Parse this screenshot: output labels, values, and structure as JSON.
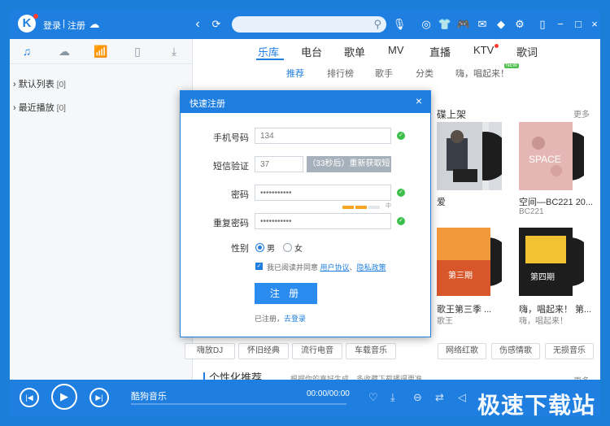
{
  "topbar": {
    "logo": "K",
    "login": "登录",
    "separator": "|",
    "register": "注册",
    "search_placeholder": ""
  },
  "sidebar": {
    "tabs": [
      "music-note-icon",
      "cloud-icon",
      "radio-icon",
      "device-icon",
      "download-icon"
    ],
    "items": [
      {
        "label": "默认列表",
        "count": "[0]"
      },
      {
        "label": "最近播放",
        "count": "[0]"
      }
    ]
  },
  "nav": {
    "items": [
      "乐库",
      "电台",
      "歌单",
      "MV",
      "直播",
      "KTV",
      "歌词"
    ],
    "active": "乐库"
  },
  "subnav": {
    "items": [
      "推荐",
      "排行榜",
      "歌手",
      "分类",
      "嗨，唱起来！"
    ],
    "active": "推荐",
    "badge": "NEW"
  },
  "section_new": {
    "title_fragment": "碟上架",
    "more": "更多",
    "albums_top": [
      {
        "caption": "爱",
        "sub": ""
      },
      {
        "caption": "空间—BC221 20...",
        "sub": "BC221"
      }
    ],
    "albums_bottom": [
      {
        "caption": "歌王第三季 ...",
        "sub": "歌王"
      },
      {
        "caption": "嗨，唱起来！ 第...",
        "sub": "嗨，唱起来！"
      }
    ]
  },
  "tags": [
    "嗨放DJ",
    "怀旧经典",
    "流行电音",
    "车载音乐",
    "网络红歌",
    "伤感情歌",
    "无损音乐"
  ],
  "section_personal": {
    "title": "个性化推荐",
    "subtitle": "根据你的喜好生成，多收藏下载播得更准",
    "more": "更多"
  },
  "dialog": {
    "title": "快速注册",
    "close": "×",
    "fields": {
      "phone_label": "手机号码",
      "phone_value": "134",
      "sms_label": "短信验证",
      "sms_value": "37",
      "sms_button": "（33秒后）重新获取短信",
      "password_label": "密码",
      "password_value": "•••••••••••",
      "repeat_label": "重复密码",
      "repeat_value": "•••••••••••",
      "strength_label": "中",
      "gender_label": "性别",
      "male": "男",
      "female": "女"
    },
    "agree_text": "我已阅读并同意",
    "agree_link1": "用户协议",
    "agree_sep": "、",
    "agree_link2": "隐私政策",
    "submit": "注 册",
    "registered_text": "已注册，",
    "login_link": "去登录"
  },
  "player": {
    "title": "酷狗音乐",
    "time": "00:00/00:00"
  },
  "watermark": "极速下载站",
  "colors": {
    "accent": "#1f7fe0",
    "ok": "#3bbf4b",
    "strength": "#f5a623"
  }
}
